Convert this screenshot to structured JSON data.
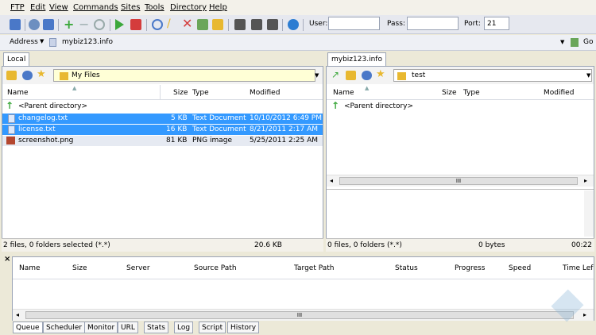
{
  "menu": [
    "FTP",
    "Edit",
    "View",
    "Commands",
    "Sites",
    "Tools",
    "Directory",
    "Help"
  ],
  "toolbar": {
    "user_label": "User:",
    "user_value": "",
    "pass_label": "Pass:",
    "pass_value": "",
    "port_label": "Port:",
    "port_value": "21"
  },
  "address": {
    "label": "Address",
    "value": "mybiz123.info",
    "go_label": "Go"
  },
  "local": {
    "tab": "Local",
    "path": "My Files",
    "columns": [
      "Name",
      "Size",
      "Type",
      "Modified"
    ],
    "parent": "<Parent directory>",
    "files": [
      {
        "name": "changelog.txt",
        "size": "5 KB",
        "type": "Text Document",
        "modified": "10/10/2012 6:49 PM"
      },
      {
        "name": "license.txt",
        "size": "16 KB",
        "type": "Text Document",
        "modified": "8/21/2011 2:17 AM"
      },
      {
        "name": "screenshot.png",
        "size": "81 KB",
        "type": "PNG image",
        "modified": "5/25/2011 2:25 AM"
      }
    ],
    "status_left": "2 files, 0 folders selected (*.*)",
    "status_size": "20.6 KB"
  },
  "remote": {
    "tab": "mybiz123.info",
    "path": "test",
    "columns": [
      "Name",
      "Size",
      "Type",
      "Modified"
    ],
    "parent": "<Parent directory>",
    "scroll_label": "III",
    "status_left": "0 files, 0 folders (*.*)",
    "status_size": "0 bytes",
    "status_time": "00:22"
  },
  "queue": {
    "close": "×",
    "columns": [
      "Name",
      "Size",
      "Server",
      "Source Path",
      "Target Path",
      "Status",
      "Progress",
      "Speed",
      "Time Lef"
    ],
    "scroll_label": "III",
    "tabs": [
      "Queue",
      "Scheduler",
      "Monitor",
      "URL",
      "Stats",
      "Log",
      "Script",
      "History"
    ]
  },
  "colors": {
    "selection": "#3399ff",
    "accent_green": "#3ca83c",
    "folder_yellow": "#e8b830"
  }
}
